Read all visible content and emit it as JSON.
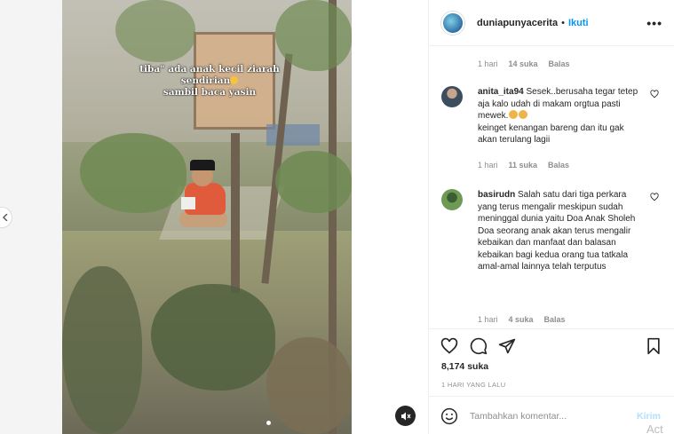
{
  "post": {
    "username": "duniapunyacerita",
    "separator": "•",
    "follow_label": "Ikuti",
    "more_label": "•••",
    "caption_overlay": "tiba\" ada anak kecil ziarah sendirian",
    "caption_overlay_tail": "sambil baca yasin",
    "likes": "8,174 suka",
    "time_ago": "1 HARI YANG LALU"
  },
  "comments": [
    {
      "meta_time": "1 hari",
      "meta_likes": "14 suka",
      "meta_reply": "Balas"
    },
    {
      "username": "anita_ita94",
      "text": "Sesek..berusaha tegar tetep aja kalo udah di makam orgtua pasti mewek.",
      "text2": "keinget kenangan bareng dan itu gak akan terulang lagii",
      "meta_time": "1 hari",
      "meta_likes": "11 suka",
      "meta_reply": "Balas"
    },
    {
      "username": "basirudn",
      "text": "Salah satu dari tiga perkara yang terus mengalir meskipun sudah meninggal dunia yaitu Doa Anak Sholeh",
      "text2": "Doa seorang anak akan terus mengalir kebaikan dan manfaat dan balasan kebaikan bagi kedua orang tua tatkala amal-amal lainnya telah terputus",
      "meta_time": "1 hari",
      "meta_likes": "4 suka",
      "meta_reply": "Balas"
    }
  ],
  "add_comment": {
    "placeholder": "Tambahkan komentar...",
    "post_label": "Kirim"
  },
  "watermark": "Act",
  "icons": {
    "like": "heart-icon",
    "comment": "comment-icon",
    "share": "share-icon",
    "save": "bookmark-icon",
    "emoji": "smile-icon",
    "mute": "speaker-muted-icon",
    "prev": "chevron-left-icon"
  },
  "colors": {
    "link_blue": "#0095f6",
    "muted_text": "#8e8e8e",
    "post_disabled": "#b2dffc"
  }
}
